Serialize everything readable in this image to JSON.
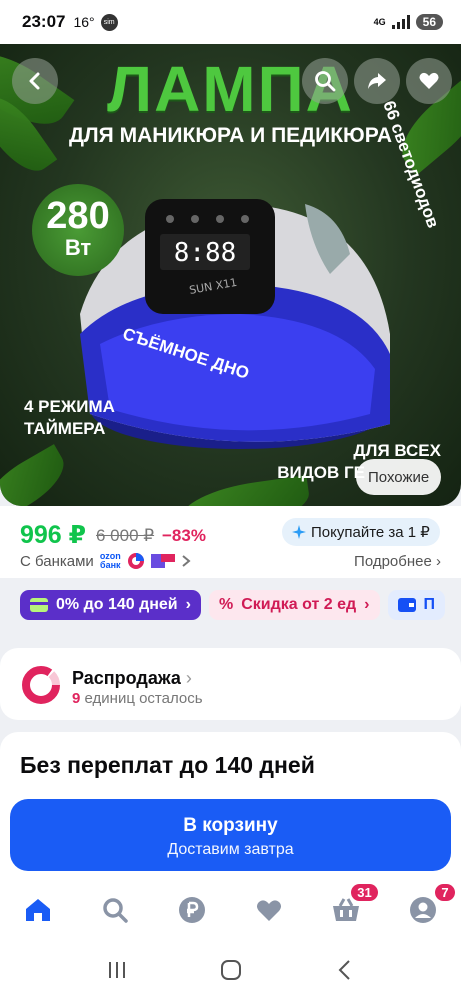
{
  "status_bar": {
    "time": "23:07",
    "temp": "16°",
    "sim": "sim",
    "network": "4G",
    "battery": "56"
  },
  "hero": {
    "title": "ЛАМПА",
    "subtitle": "ДЛЯ МАНИКЮРА И ПЕДИКЮРА",
    "watt_number": "280",
    "watt_unit": "Вт",
    "leds": "66 светодиодов",
    "removable_bottom": "СЪЁМНОЕ ДНО",
    "modes": [
      "4 РЕЖИМА",
      "ТАЙМЕРА"
    ],
    "all_kinds": [
      "ДЛЯ ВСЕХ",
      "ВИДОВ ГЕ"
    ],
    "lamp_brand": "SUN X11",
    "lamp_display": "8:88",
    "similar_button": "Похожие"
  },
  "price": {
    "current": "996 ₽",
    "old": "6 000 ₽",
    "discount": "−83%",
    "promo": "Покупайте за 1 ₽",
    "banks_label": "С банками",
    "ozon_bank": [
      "ozon",
      "банк"
    ],
    "details": "Подробнее"
  },
  "chips": [
    {
      "label": "0% до 140 дней"
    },
    {
      "label": "Скидка от 2 ед"
    },
    {
      "label": "П"
    }
  ],
  "sale": {
    "title": "Распродажа",
    "count": "9",
    "count_text": "единиц осталось"
  },
  "installment": {
    "title": "Без переплат до 140 дней"
  },
  "cart": {
    "button": "В корзину",
    "subtitle": "Доставим завтра"
  },
  "nav": {
    "cart_badge": "31",
    "profile_badge": "7"
  },
  "colors": {
    "accent": "#1a5cf5",
    "price_green": "#10c44c",
    "discount_pink": "#e0245e",
    "chip_purple": "#5b2fc9"
  }
}
